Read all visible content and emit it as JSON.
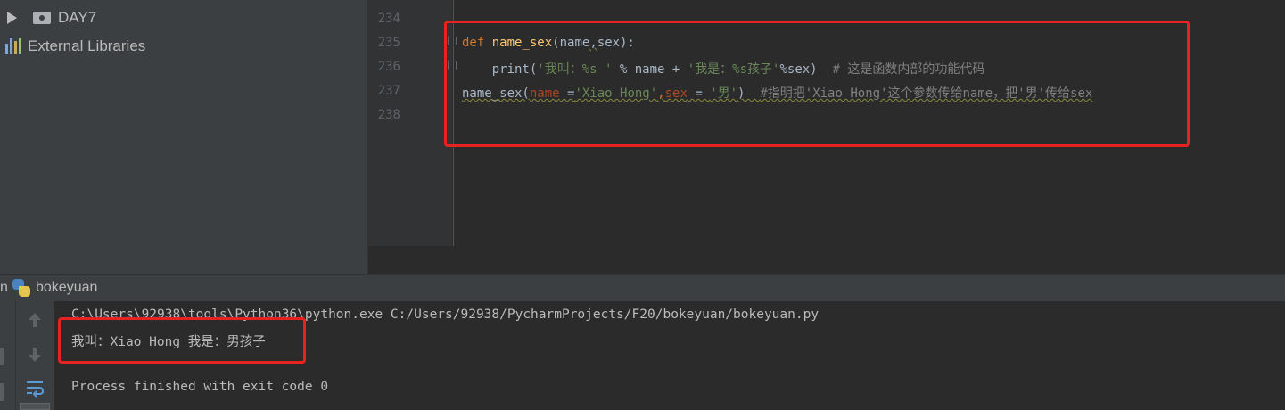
{
  "project_tree": {
    "items": [
      {
        "label": "DAY7",
        "icon": "folder-icon"
      },
      {
        "label": "External Libraries",
        "icon": "library-icon"
      }
    ]
  },
  "editor": {
    "line_numbers": [
      "234",
      "235",
      "236",
      "237",
      "238"
    ],
    "lines": {
      "l235": {
        "kw": "def",
        "fn": "name_sex",
        "open": "(name",
        "comma": ",",
        "rest": "sex):"
      },
      "l236": {
        "indent": "    ",
        "call": "print(",
        "s1": "'我叫：%s '",
        "mid": " % name + ",
        "s2": "'我是：%s孩子'",
        "tail": "%sex)  ",
        "comment": "# 这是函数内部的功能代码"
      },
      "l237": {
        "call": "name_sex(",
        "p1": "name",
        "eq1": " =",
        "s1": "'Xiao Hong'",
        "comma": ",",
        "p2": "sex",
        "eq2": " = ",
        "s2": "'男'",
        "close": ")  ",
        "comment": "#指明把'Xiao Hong'这个参数传给name，把'男'传给sex"
      }
    }
  },
  "run_panel": {
    "tab_label": "bokeyuan",
    "tab_prefix": "n"
  },
  "console": {
    "command": "C:\\Users\\92938\\tools\\Python36\\python.exe C:/Users/92938/PycharmProjects/F20/bokeyuan/bokeyuan.py",
    "output": "我叫：Xiao Hong 我是：男孩子",
    "exit": "Process finished with exit code 0"
  },
  "colors": {
    "highlight_box": "#e82121",
    "keyword": "#cc7832",
    "function": "#ffc66d",
    "string": "#6a8759",
    "comment": "#808080"
  }
}
